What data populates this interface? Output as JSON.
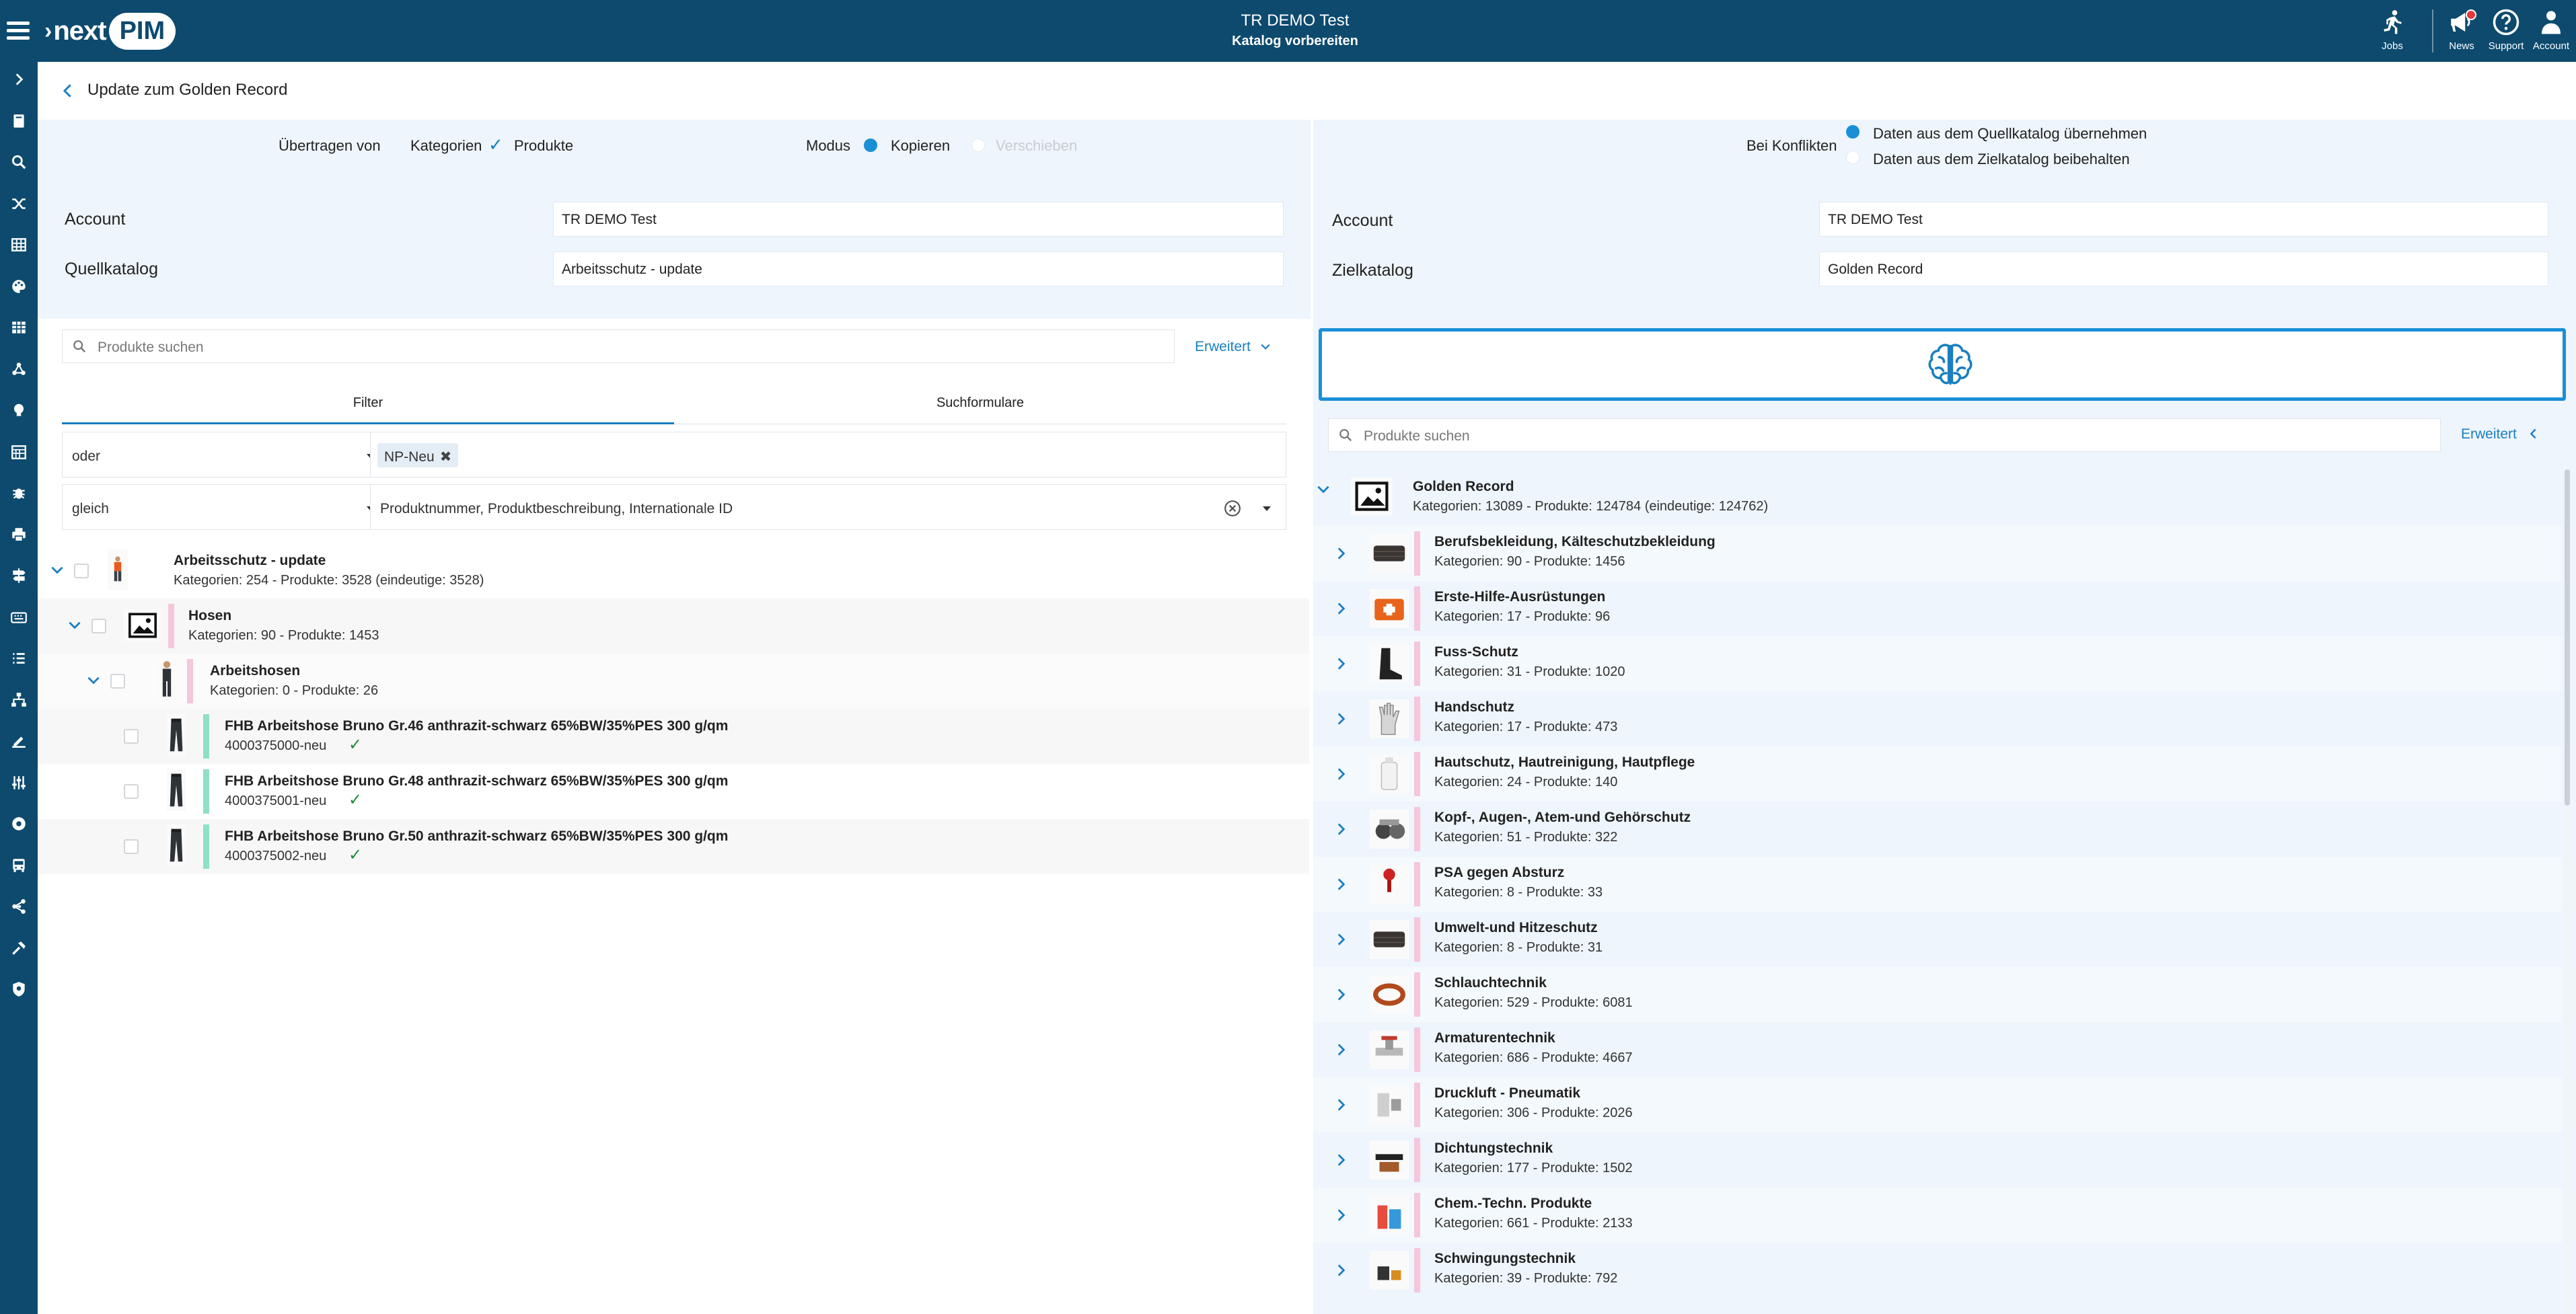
{
  "topbar": {
    "account_line": "TR DEMO Test",
    "task_line": "Katalog vorbereiten",
    "logo_text": "next",
    "logo_pill": "PIM",
    "actions": [
      {
        "label": "Jobs",
        "icon": "running-person-icon"
      },
      {
        "label": "News",
        "icon": "megaphone-icon"
      },
      {
        "label": "Support",
        "icon": "help-circle-icon"
      },
      {
        "label": "Account",
        "icon": "user-icon"
      }
    ]
  },
  "rail_icons": [
    "chevron-right-icon",
    "book-icon",
    "search-icon",
    "shuffle-icon",
    "table-icon",
    "palette-icon",
    "grid-icon",
    "molecule-icon",
    "lightbulb-icon",
    "calendar-grid-icon",
    "bug-icon",
    "printer-icon",
    "sign-icon",
    "keyboard-icon",
    "list-icon",
    "sitemap-icon",
    "ruler-edit-icon",
    "sliders-icon",
    "gear-badge-icon",
    "bus-icon",
    "share-nodes-icon",
    "hammer-icon",
    "shield-gear-icon"
  ],
  "page": {
    "title": "Update zum Golden Record"
  },
  "left": {
    "transfer_label": "Übertragen von",
    "opt_categories": "Kategorien",
    "opt_products": "Produkte",
    "mode_label": "Modus",
    "mode_copy": "Kopieren",
    "mode_move": "Verschieben",
    "account_label": "Account",
    "account_value": "TR DEMO Test",
    "source_label": "Quellkatalog",
    "source_value": "Arbeitsschutz  - update",
    "search_placeholder": "Produkte suchen",
    "advanced": "Erweitert",
    "tabs": [
      "Filter",
      "Suchformulare"
    ],
    "filter_logic": "oder",
    "filter_chip": "NP-Neu",
    "filter_operator": "gleich",
    "filter_fields": "Produktnummer, Produktbeschreibung, Internationale ID",
    "tree": [
      {
        "title": "Arbeitsschutz - update",
        "sub": "Kategorien: 254 - Produkte: 3528 (eindeutige: 3528)"
      },
      {
        "title": "Hosen",
        "sub": "Kategorien: 90 - Produkte: 1453"
      },
      {
        "title": "Arbeitshosen",
        "sub": "Kategorien: 0 - Produkte: 26"
      },
      {
        "title": "FHB Arbeitshose Bruno Gr.46 anthrazit-schwarz 65%BW/35%PES 300 g/qm",
        "sub": "4000375000-neu"
      },
      {
        "title": "FHB Arbeitshose Bruno Gr.48 anthrazit-schwarz 65%BW/35%PES 300 g/qm",
        "sub": "4000375001-neu"
      },
      {
        "title": "FHB Arbeitshose Bruno Gr.50 anthrazit-schwarz 65%BW/35%PES 300 g/qm",
        "sub": "4000375002-neu"
      }
    ]
  },
  "right": {
    "conflict_label": "Bei Konflikten",
    "conflict_opt1": "Daten aus dem Quellkatalog übernehmen",
    "conflict_opt2": "Daten aus dem Zielkatalog beibehalten",
    "account_label": "Account",
    "account_value": "TR DEMO Test",
    "target_label": "Zielkatalog",
    "target_value": "Golden Record",
    "search_placeholder": "Produkte suchen",
    "advanced": "Erweitert",
    "root": {
      "title": "Golden Record",
      "sub": "Kategorien: 13089 - Produkte: 124784 (eindeutige: 124762)"
    },
    "categories": [
      {
        "title": "Berufsbekleidung, Kälteschutzbekleidung",
        "sub": "Kategorien: 90 - Produkte: 1456"
      },
      {
        "title": "Erste-Hilfe-Ausrüstungen",
        "sub": "Kategorien: 17 - Produkte: 96"
      },
      {
        "title": "Fuss-Schutz",
        "sub": "Kategorien: 31 - Produkte: 1020"
      },
      {
        "title": "Handschutz",
        "sub": "Kategorien: 17 - Produkte: 473"
      },
      {
        "title": "Hautschutz, Hautreinigung, Hautpflege",
        "sub": "Kategorien: 24 - Produkte: 140"
      },
      {
        "title": "Kopf-, Augen-, Atem-und Gehörschutz",
        "sub": "Kategorien: 51 - Produkte: 322"
      },
      {
        "title": "PSA gegen Absturz",
        "sub": "Kategorien: 8 - Produkte: 33"
      },
      {
        "title": "Umwelt-und Hitzeschutz",
        "sub": "Kategorien: 8 - Produkte: 31"
      },
      {
        "title": "Schlauchtechnik",
        "sub": "Kategorien: 529 - Produkte: 6081"
      },
      {
        "title": "Armaturentechnik",
        "sub": "Kategorien: 686 - Produkte: 4667"
      },
      {
        "title": "Druckluft - Pneumatik",
        "sub": "Kategorien: 306 - Produkte: 2026"
      },
      {
        "title": "Dichtungstechnik",
        "sub": "Kategorien: 177 - Produkte: 1502"
      },
      {
        "title": "Chem.-Techn. Produkte",
        "sub": "Kategorien: 661 - Produkte: 2133"
      },
      {
        "title": "Schwingungstechnik",
        "sub": "Kategorien: 39 - Produkte: 792"
      }
    ]
  },
  "colors": {
    "header": "#0d4a6e",
    "accent": "#1a7fc1",
    "category_marker": "#f6c6dc",
    "product_marker": "#8fe0c8",
    "ok": "#1e8a3a"
  }
}
